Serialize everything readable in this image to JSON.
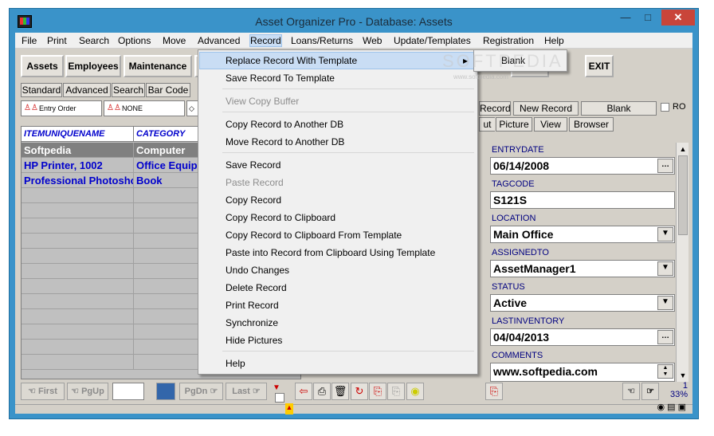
{
  "window": {
    "title": "Asset Organizer Pro - Database: Assets"
  },
  "menubar": [
    "File",
    "Print",
    "Search",
    "Options",
    "Move",
    "Advanced",
    "Record",
    "Loans/Returns",
    "Web",
    "Update/Templates",
    "Registration",
    "Help"
  ],
  "toolbar": {
    "assets": "Assets",
    "employees": "Employees",
    "maintenance": "Maintenance",
    "ad_fragment": "ad",
    "exit": "EXIT"
  },
  "subtabs": [
    "Standard",
    "Advanced",
    "Search",
    "Bar Code"
  ],
  "sort": {
    "order": "Entry Order",
    "filter": "NONE"
  },
  "grid": {
    "headers": [
      "ITEMUNIQUENAME",
      "CATEGORY"
    ],
    "rows": [
      [
        "Softpedia",
        "Computer"
      ],
      [
        "HP Printer, 1002",
        "Office Equip"
      ],
      [
        "Professional Photoshop",
        "Book"
      ]
    ]
  },
  "record_buttons": {
    "record_fragment": "Record",
    "new_record": "New Record",
    "blank": "Blank",
    "ro": "RO"
  },
  "right_tabs": [
    "ut",
    "Picture",
    "View",
    "Browser"
  ],
  "fields": [
    {
      "label": "ENTRYDATE",
      "value": "06/14/2008",
      "control": "dots"
    },
    {
      "label": "TAGCODE",
      "value": "S121S",
      "control": "none"
    },
    {
      "label": "LOCATION",
      "value": "Main Office",
      "control": "dropdown"
    },
    {
      "label": "ASSIGNEDTO",
      "value": "AssetManager1",
      "control": "dropdown"
    },
    {
      "label": "STATUS",
      "value": "Active",
      "control": "dropdown"
    },
    {
      "label": "LASTINVENTORY",
      "value": "04/04/2013",
      "control": "dots"
    },
    {
      "label": "COMMENTS",
      "value": "www.softpedia.com",
      "control": "spin"
    }
  ],
  "nav": {
    "first": "First",
    "pgup": "PgUp",
    "pgdn": "PgDn",
    "last": "Last"
  },
  "status": {
    "percent": "33%",
    "count": "1"
  },
  "record_menu": {
    "items": [
      {
        "label": "Replace Record With Template",
        "state": "hover",
        "submenu": true
      },
      {
        "label": "Save Record To Template",
        "state": "normal"
      },
      {
        "label": "View Copy Buffer",
        "state": "disabled"
      },
      {
        "label": "Copy Record to Another DB",
        "state": "normal"
      },
      {
        "label": "Move Record to Another DB",
        "state": "normal"
      },
      {
        "label": "Save Record",
        "state": "normal"
      },
      {
        "label": "Paste Record",
        "state": "disabled"
      },
      {
        "label": "Copy Record",
        "state": "normal"
      },
      {
        "label": "Copy Record to Clipboard",
        "state": "normal"
      },
      {
        "label": "Copy Record to Clipboard From Template",
        "state": "normal"
      },
      {
        "label": "Paste into Record from Clipboard Using Template",
        "state": "normal"
      },
      {
        "label": "Undo Changes",
        "state": "normal"
      },
      {
        "label": "Delete Record",
        "state": "normal"
      },
      {
        "label": "Print Record",
        "state": "normal"
      },
      {
        "label": "Synchronize",
        "state": "normal"
      },
      {
        "label": "Hide Pictures",
        "state": "normal"
      },
      {
        "label": "Help",
        "state": "normal"
      }
    ],
    "submenu": [
      "Blank"
    ]
  },
  "watermark": {
    "main": "SOFTPEDIA",
    "sub": "www.softpedia.com"
  },
  "colors": {
    "titlebar": "#3a93c9",
    "close": "#c9453a",
    "grid_text": "#0000cc",
    "field_label": "#000080",
    "menu_hover": "#c9ddf4"
  }
}
